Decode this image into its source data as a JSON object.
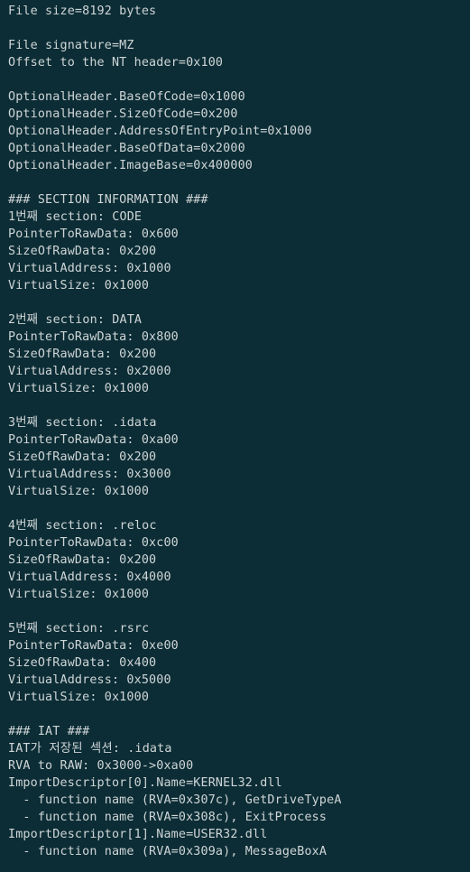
{
  "terminal": {
    "lines": [
      "File size=8192 bytes",
      "",
      "File signature=MZ",
      "Offset to the NT header=0x100",
      "",
      "OptionalHeader.BaseOfCode=0x1000",
      "OptionalHeader.SizeOfCode=0x200",
      "OptionalHeader.AddressOfEntryPoint=0x1000",
      "OptionalHeader.BaseOfData=0x2000",
      "OptionalHeader.ImageBase=0x400000",
      "",
      "### SECTION INFORMATION ###",
      "1번째 section: CODE",
      "PointerToRawData: 0x600",
      "SizeOfRawData: 0x200",
      "VirtualAddress: 0x1000",
      "VirtualSize: 0x1000",
      "",
      "2번째 section: DATA",
      "PointerToRawData: 0x800",
      "SizeOfRawData: 0x200",
      "VirtualAddress: 0x2000",
      "VirtualSize: 0x1000",
      "",
      "3번째 section: .idata",
      "PointerToRawData: 0xa00",
      "SizeOfRawData: 0x200",
      "VirtualAddress: 0x3000",
      "VirtualSize: 0x1000",
      "",
      "4번째 section: .reloc",
      "PointerToRawData: 0xc00",
      "SizeOfRawData: 0x200",
      "VirtualAddress: 0x4000",
      "VirtualSize: 0x1000",
      "",
      "5번째 section: .rsrc",
      "PointerToRawData: 0xe00",
      "SizeOfRawData: 0x400",
      "VirtualAddress: 0x5000",
      "VirtualSize: 0x1000",
      "",
      "### IAT ###",
      "IAT가 저장된 섹션: .idata",
      "RVA to RAW: 0x3000->0xa00",
      "ImportDescriptor[0].Name=KERNEL32.dll",
      "  - function name (RVA=0x307c), GetDriveTypeA",
      "  - function name (RVA=0x308c), ExitProcess",
      "ImportDescriptor[1].Name=USER32.dll",
      "  - function name (RVA=0x309a), MessageBoxA"
    ]
  }
}
